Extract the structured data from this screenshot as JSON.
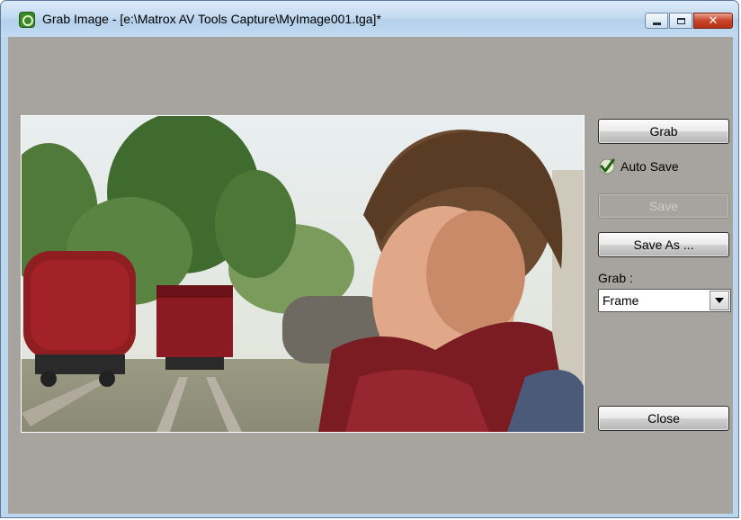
{
  "window": {
    "title": "Grab Image - [e:\\Matrox AV Tools Capture\\MyImage001.tga]*",
    "icon": "matrox-app-icon"
  },
  "caption_buttons": {
    "minimize": "minimize-icon",
    "maximize": "maximize-icon",
    "close": "✕"
  },
  "preview": {
    "description_icon": "captured-frame-image"
  },
  "controls": {
    "grab_button": "Grab",
    "auto_save_label": "Auto Save",
    "auto_save_checked": true,
    "save_button": "Save",
    "save_as_button": "Save As ...",
    "grab_mode_label": "Grab :",
    "grab_mode_value": "Frame",
    "close_button": "Close"
  },
  "colors": {
    "client_bg": "#a7a39f",
    "titlebar": "#c4dbf1",
    "checkmark": "#2e7d1e"
  }
}
